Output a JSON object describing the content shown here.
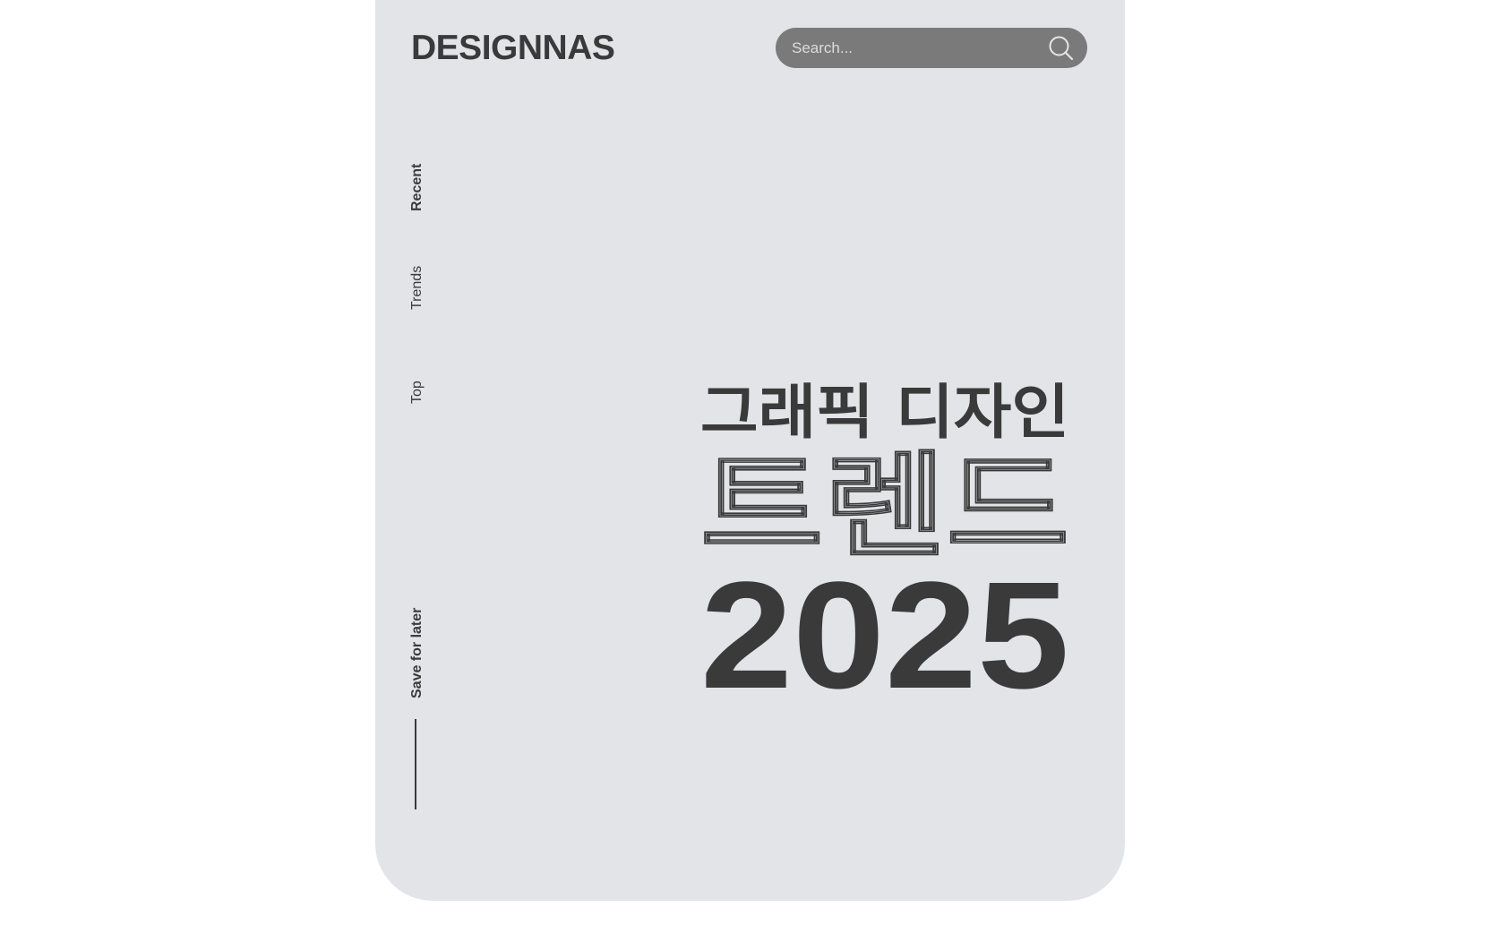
{
  "brand": {
    "name": "DESIGNNAS"
  },
  "search": {
    "placeholder": "Search...",
    "value": "",
    "icon": "search-icon"
  },
  "side_nav": {
    "items": [
      {
        "label": "Recent",
        "bold": true
      },
      {
        "label": "Trends",
        "bold": false
      },
      {
        "label": "Top",
        "bold": false
      }
    ],
    "save_label": "Save for later"
  },
  "hero": {
    "line1": "그래픽 디자인",
    "line2": "트렌드",
    "line3": "2025"
  },
  "colors": {
    "page_background": "#ffffff",
    "card_background": "#e2e4e8",
    "text_dark": "#3a3a3a",
    "search_background": "#7a7a7a"
  }
}
